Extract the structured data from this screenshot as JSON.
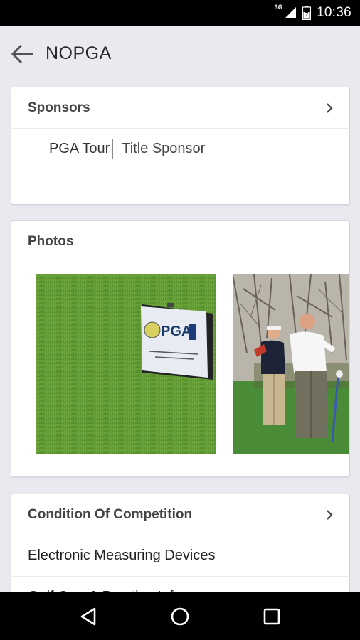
{
  "status_bar": {
    "time": "10:36",
    "network": "3G"
  },
  "app_bar": {
    "title": "NOPGA"
  },
  "sponsors": {
    "title": "Sponsors",
    "items": [
      {
        "logo_text": "PGA Tour",
        "role": "Title Sponsor"
      }
    ]
  },
  "photos": {
    "title": "Photos",
    "items": [
      {
        "sign_text": "PGA"
      }
    ]
  },
  "conditions": {
    "title": "Condition Of Competition",
    "items": [
      "Electronic Measuring Devices",
      "Golf Cart & Practice Info"
    ]
  },
  "colors": {
    "background": "#e9e9ef",
    "card": "#ffffff",
    "status_bar": "#000000"
  }
}
